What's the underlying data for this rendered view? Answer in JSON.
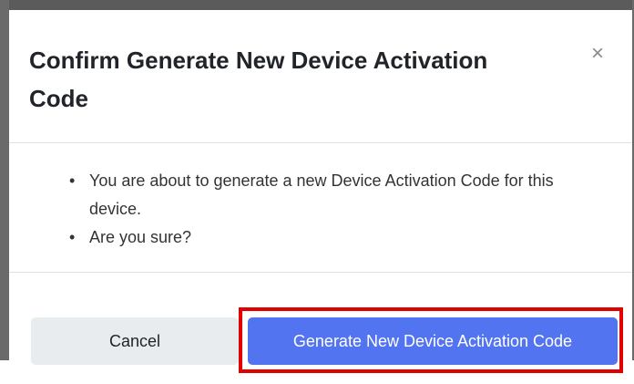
{
  "modal": {
    "title": "Confirm Generate New Device Activation Code",
    "close_symbol": "×",
    "close_icon": "close-icon",
    "body_items": [
      "You are about to generate a new Device Activation Code for this device.",
      "Are you sure?"
    ],
    "buttons": {
      "cancel_label": "Cancel",
      "generate_label": "Generate New Device Activation Code"
    }
  },
  "colors": {
    "primary_button": "#5374f0",
    "cancel_button": "#e9ecef",
    "highlight_outline": "#e00000",
    "backdrop": "#5b5b5b"
  }
}
